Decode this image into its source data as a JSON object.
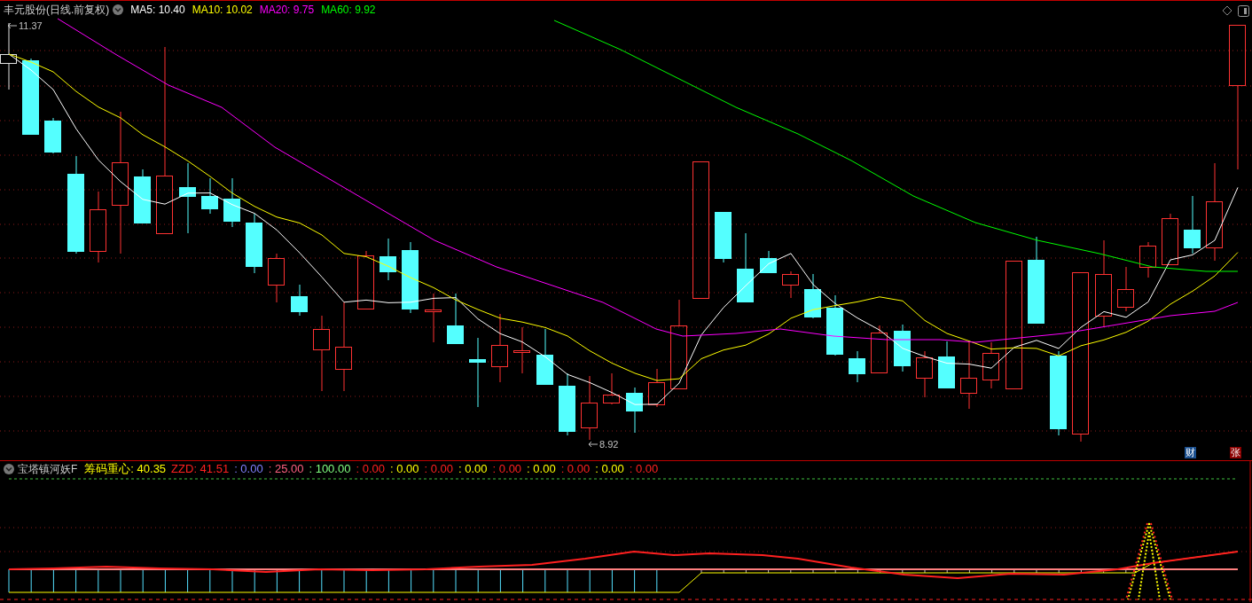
{
  "header": {
    "title": "丰元股份(日线.前复权)",
    "legend": [
      {
        "text": "MA5: 10.40",
        "color": "#ffffff"
      },
      {
        "text": "MA10: 10.02",
        "color": "#ffff00"
      },
      {
        "text": "MA20: 9.75",
        "color": "#ff00ff"
      },
      {
        "text": "MA60: 9.92",
        "color": "#00ff00"
      }
    ]
  },
  "price_labels": [
    {
      "text": "11.37",
      "kind": "high"
    },
    {
      "text": "8.92",
      "kind": "low"
    }
  ],
  "badges": [
    {
      "text": "财",
      "color": "#1a4f8f"
    },
    {
      "text": "张",
      "color": "#8b0000"
    }
  ],
  "indicator": {
    "title": "宝塔镇河妖F",
    "values": [
      {
        "text": "筹码重心: 40.35",
        "color": "#ffff00"
      },
      {
        "text": "ZZD: 41.51",
        "color": "#ff2020"
      },
      {
        "text": ": 0.00",
        "color": "#8080ff"
      },
      {
        "text": ": 25.00",
        "color": "#ff6080"
      },
      {
        "text": ": 100.00",
        "color": "#80ff80"
      },
      {
        "text": ": 0.00",
        "color": "#ff2020"
      },
      {
        "text": ": 0.00",
        "color": "#ffff00"
      },
      {
        "text": ": 0.00",
        "color": "#ff2020"
      },
      {
        "text": ": 0.00",
        "color": "#ffff00"
      },
      {
        "text": ": 0.00",
        "color": "#ff2020"
      },
      {
        "text": ": 0.00",
        "color": "#ffff00"
      },
      {
        "text": ": 0.00",
        "color": "#ff2020"
      },
      {
        "text": ": 0.00",
        "color": "#ffff00"
      },
      {
        "text": ": 0.00",
        "color": "#ff2020"
      }
    ]
  }
}
